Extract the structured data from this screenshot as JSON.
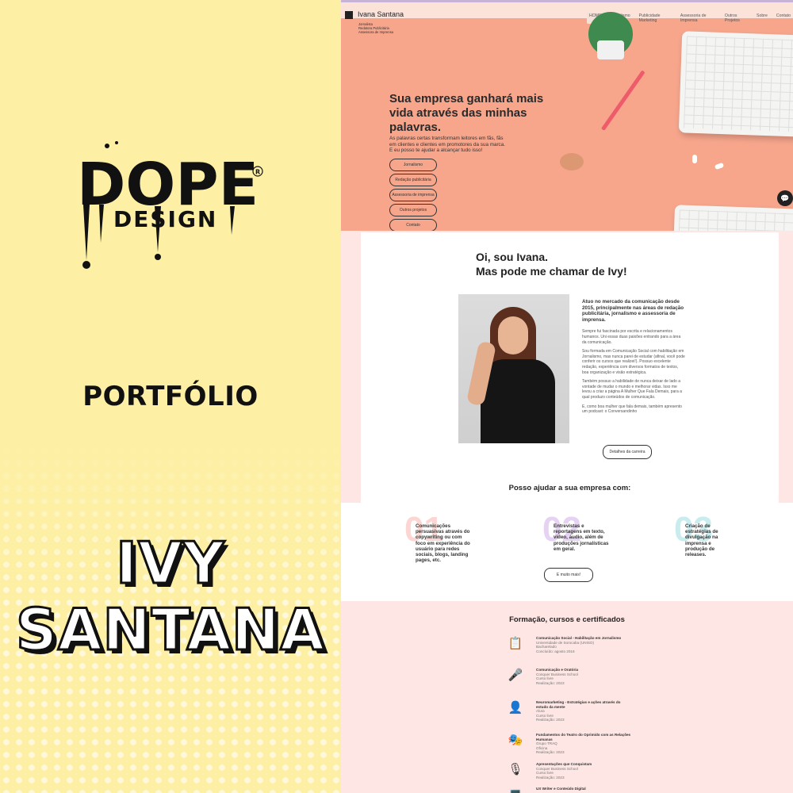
{
  "left": {
    "logo_main": "DOPE",
    "logo_sub": "DESIGN",
    "logo_mark": "R",
    "portfolio_label": "PORTFÓLIO",
    "name_line1": "IVY",
    "name_line2": "SANTANA"
  },
  "site": {
    "name": "Ivana Santana",
    "subtitle": [
      "Jornalista",
      "Redatora Publicitária",
      "Assessora de Imprensa"
    ],
    "nav": [
      "HOME",
      "Jornalismo",
      "Publicidade Marketing",
      "Assessoria de Imprensa",
      "Outros Projetos",
      "Sobre",
      "Contato"
    ],
    "headline": "Sua empresa ganhará mais vida através das minhas palavras.",
    "intro": "As palavras certas transformam leitores em fãs, fãs em clientes e clientes em promotores da sua marca. E eu posso te ajudar a alcançar tudo isso!",
    "hero_buttons": [
      "Jornalismo",
      "Redação publicitária",
      "Assessoria de imprensa",
      "Outros projetos",
      "Contato"
    ],
    "about": {
      "title_line1": "Oi, sou Ivana.",
      "title_line2": "Mas pode me chamar de Ivy!",
      "lead": "Atuo no mercado da comunicação desde 2015, principalmente nas áreas de redação publicitária, jornalismo e assessoria de imprensa.",
      "p1": "Sempre fui fascinada por escrita e relacionamentos humanos. Uni essas duas paixões entrando para a área da comunicação.",
      "p2": "Sou formada em Comunicação Social com habilitação em Jornalismo, mas nunca parei de estudar (afinal, você pode conferir os cursos que realizei!). Possuo excelente redação, experiência com diversos formatos de textos, boa organização e visão estratégica.",
      "p3": "Também possuo a habilidade de nunca deixar de lado a vontade de mudar o mundo e melhorar vidas. Isso me levou a criar a página A Mulher Que Fala Demais, para a qual produzo conteúdos de comunicação.",
      "p4": "E, como boa mulher que fala demais, também apresento um podcast: o Conversandinho",
      "button": "Detalhes da carreira"
    },
    "help_title": "Posso ajudar a sua empresa com:",
    "services": [
      {
        "num": "01",
        "text": "Comunicações persuasivas através do copywriting ou com foco em experiência do usuário para redes sociais, blogs, landing pages, etc.",
        "color": "#fbd6d2"
      },
      {
        "num": "02",
        "text": "Entrevistas e reportagens em texto, vídeo, áudio, além de produções jornalísticas em geral.",
        "color": "#e6d3f4"
      },
      {
        "num": "03",
        "text": "Criação de estratégias de divulgação na imprensa e produção de releases.",
        "color": "#c9ecee"
      }
    ],
    "services_button": "E muito mais!",
    "edu_title": "Formação, cursos e certificados",
    "edu": [
      {
        "icon": "📋",
        "title": "Comunicação Social - Habilitação em Jornalismo",
        "lines": [
          "Universidade de Sorocaba (UNISO)",
          "Bacharelado",
          "Concluído: agosto 2018"
        ]
      },
      {
        "icon": "🎤",
        "title": "Comunicação e Oratória",
        "lines": [
          "Conquer Business School",
          "Curso livre",
          "Realização: 2023"
        ]
      },
      {
        "icon": "👤",
        "title": "Neuromarketing - Estratégias e ações através do estudo da mente",
        "lines": [
          "Alura",
          "Curso livre",
          "Realização: 2023"
        ]
      },
      {
        "icon": "🎭",
        "title": "Fundamentos do Teatro do Oprimido com as Relações Humanas",
        "lines": [
          "Grupo TRAQ",
          "Oficina",
          "Realização: 2023"
        ]
      },
      {
        "icon": "🎙",
        "title": "Apresentações que Conquistam",
        "lines": [
          "Conquer Business School",
          "Curso livre",
          "Realização: 2023"
        ]
      },
      {
        "icon": "💻",
        "title": "UX Writer e Conteúdo Digital",
        "lines": []
      }
    ]
  }
}
